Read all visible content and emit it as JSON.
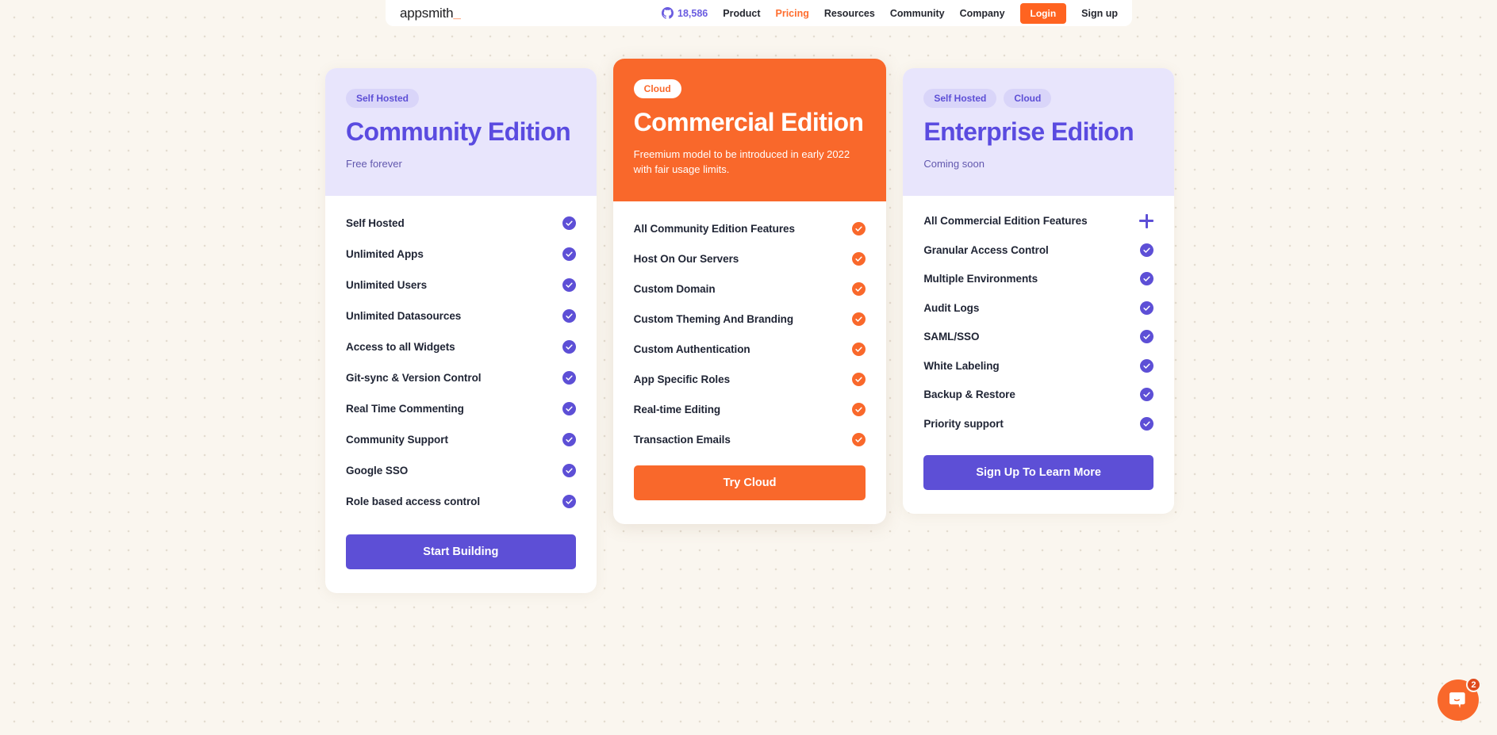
{
  "navbar": {
    "brand": "appsmith",
    "brand_cursor": "_",
    "github": {
      "icon": "github-icon",
      "stars": "18,586"
    },
    "links": [
      {
        "label": "Product",
        "active": false
      },
      {
        "label": "Pricing",
        "active": true
      },
      {
        "label": "Resources",
        "active": false
      },
      {
        "label": "Community",
        "active": false
      },
      {
        "label": "Company",
        "active": false
      }
    ],
    "login_label": "Login",
    "signup_label": "Sign up"
  },
  "plans": [
    {
      "id": "community",
      "badges": [
        "Self Hosted"
      ],
      "title": "Community Edition",
      "subtitle": "Free forever",
      "cta": "Start Building",
      "features": [
        {
          "label": "Self Hosted",
          "icon": "check-circle-icon"
        },
        {
          "label": "Unlimited Apps",
          "icon": "check-circle-icon"
        },
        {
          "label": "Unlimited Users",
          "icon": "check-circle-icon"
        },
        {
          "label": "Unlimited Datasources",
          "icon": "check-circle-icon"
        },
        {
          "label": "Access to all Widgets",
          "icon": "check-circle-icon"
        },
        {
          "label": "Git-sync & Version Control",
          "icon": "check-circle-icon"
        },
        {
          "label": "Real Time Commenting",
          "icon": "check-circle-icon"
        },
        {
          "label": "Community Support",
          "icon": "check-circle-icon"
        },
        {
          "label": "Google SSO",
          "icon": "check-circle-icon"
        },
        {
          "label": "Role based access control",
          "icon": "check-circle-icon"
        }
      ]
    },
    {
      "id": "commercial",
      "badges": [
        "Cloud"
      ],
      "title": "Commercial Edition",
      "subtitle": "Freemium model to be introduced in early 2022 with fair usage limits.",
      "cta": "Try Cloud",
      "features": [
        {
          "label": "All Community Edition Features",
          "icon": "check-circle-icon"
        },
        {
          "label": "Host On Our Servers",
          "icon": "check-circle-icon"
        },
        {
          "label": "Custom Domain",
          "icon": "check-circle-icon"
        },
        {
          "label": "Custom Theming And Branding",
          "icon": "check-circle-icon"
        },
        {
          "label": "Custom Authentication",
          "icon": "check-circle-icon"
        },
        {
          "label": "App Specific Roles",
          "icon": "check-circle-icon"
        },
        {
          "label": "Real-time Editing",
          "icon": "check-circle-icon"
        },
        {
          "label": "Transaction Emails",
          "icon": "check-circle-icon"
        }
      ]
    },
    {
      "id": "enterprise",
      "badges": [
        "Self Hosted",
        "Cloud"
      ],
      "title": "Enterprise Edition",
      "subtitle": "Coming soon",
      "cta": "Sign Up To Learn More",
      "features": [
        {
          "label": "All Commercial Edition Features",
          "icon": "plus-icon"
        },
        {
          "label": "Granular Access Control",
          "icon": "check-circle-icon"
        },
        {
          "label": "Multiple Environments",
          "icon": "check-circle-icon"
        },
        {
          "label": "Audit Logs",
          "icon": "check-circle-icon"
        },
        {
          "label": "SAML/SSO",
          "icon": "check-circle-icon"
        },
        {
          "label": "White Labeling",
          "icon": "check-circle-icon"
        },
        {
          "label": "Backup & Restore",
          "icon": "check-circle-icon"
        },
        {
          "label": "Priority support",
          "icon": "check-circle-icon"
        }
      ]
    }
  ],
  "chat": {
    "icon": "chat-bubble-icon",
    "unread": "2"
  },
  "colors": {
    "accent_orange": "#f9682b",
    "accent_purple": "#5d4fd6",
    "page_bg": "#faf6ef",
    "lavender": "#e8e5fc"
  }
}
